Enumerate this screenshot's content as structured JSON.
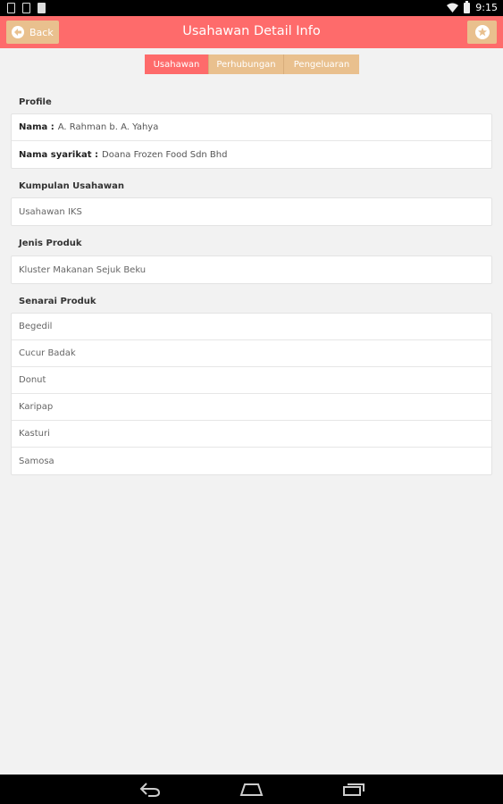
{
  "status_bar": {
    "time": "9:15"
  },
  "action_bar": {
    "back_label": "Back",
    "title": "Usahawan Detail Info"
  },
  "tabs": [
    {
      "label": "Usahawan",
      "active": true
    },
    {
      "label": "Perhubungan",
      "active": false
    },
    {
      "label": "Pengeluaran",
      "active": false
    }
  ],
  "profile": {
    "heading": "Profile",
    "nama_label": "Nama :",
    "nama_value": "A. Rahman b. A. Yahya",
    "syarikat_label": "Nama syarikat :",
    "syarikat_value": "Doana Frozen Food Sdn Bhd"
  },
  "kumpulan": {
    "heading": "Kumpulan Usahawan",
    "value": "Usahawan IKS"
  },
  "jenis": {
    "heading": "Jenis Produk",
    "value": "Kluster Makanan Sejuk Beku"
  },
  "senarai": {
    "heading": "Senarai Produk",
    "items": [
      "Begedil",
      "Cucur Badak",
      "Donut",
      "Karipap",
      "Kasturi",
      "Samosa"
    ]
  },
  "colors": {
    "primary": "#fe6b6b",
    "secondary": "#e9c08e",
    "background": "#f2f2f2"
  },
  "icons": {
    "back": "arrow-left-icon",
    "star": "star-icon",
    "nav_back": "nav-back-icon",
    "nav_home": "nav-home-icon",
    "nav_recents": "nav-recents-icon"
  }
}
